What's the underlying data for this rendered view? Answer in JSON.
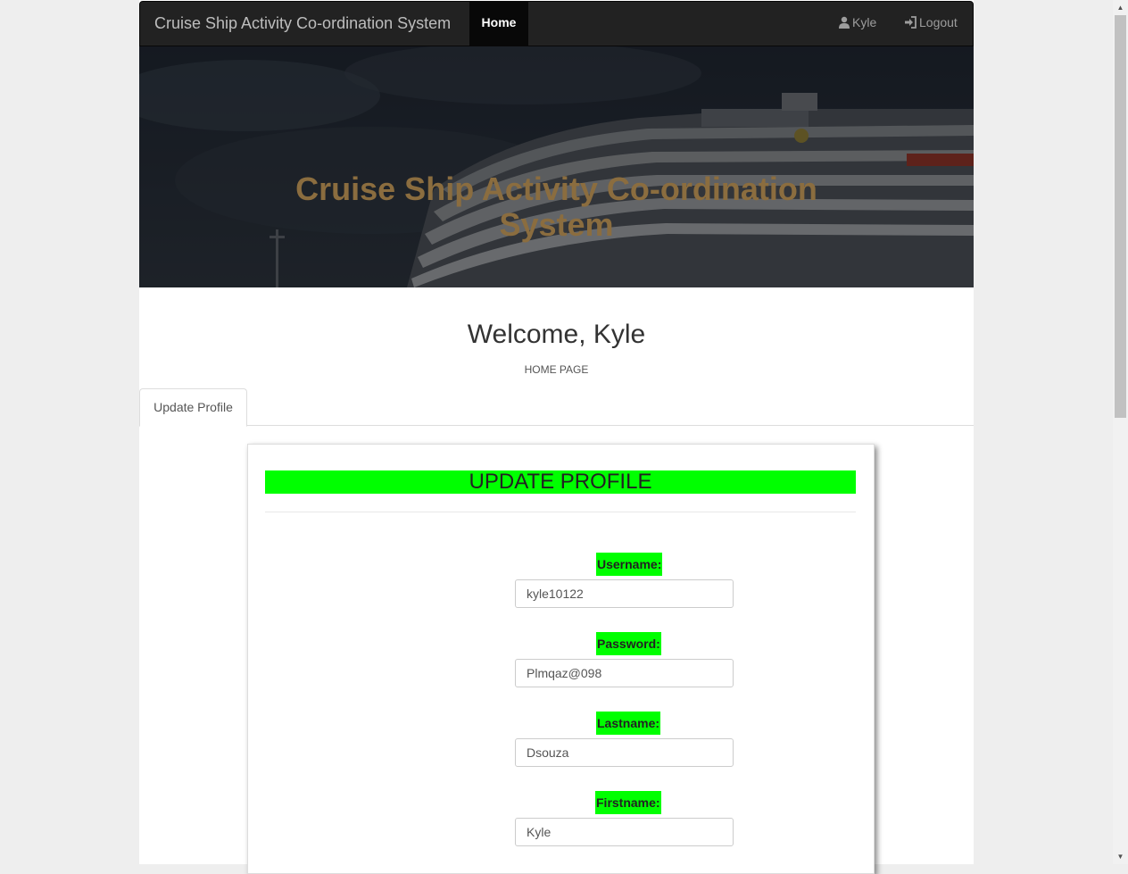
{
  "navbar": {
    "brand": "Cruise Ship Activity Co-ordination System",
    "home": "Home",
    "user": "Kyle",
    "logout": "Logout"
  },
  "hero": {
    "title_line1": "Cruise Ship Activity Co-ordination",
    "title_line2": "System"
  },
  "welcome": {
    "heading": "Welcome, Kyle",
    "subtitle": "HOME PAGE"
  },
  "tabs": [
    {
      "label": "Update Profile"
    }
  ],
  "form": {
    "title": "UPDATE PROFILE",
    "fields": [
      {
        "label": "Username:",
        "value": "kyle10122"
      },
      {
        "label": "Password:",
        "value": "Plmqaz@098"
      },
      {
        "label": "Lastname:",
        "value": "Dsouza"
      },
      {
        "label": "Firstname:",
        "value": "Kyle"
      }
    ]
  },
  "colors": {
    "navbar_bg": "#222222",
    "highlight": "#00ff00",
    "hero_title": "#8b6d3f"
  },
  "icons": {
    "user": "user-icon",
    "logout": "log-in-icon"
  }
}
